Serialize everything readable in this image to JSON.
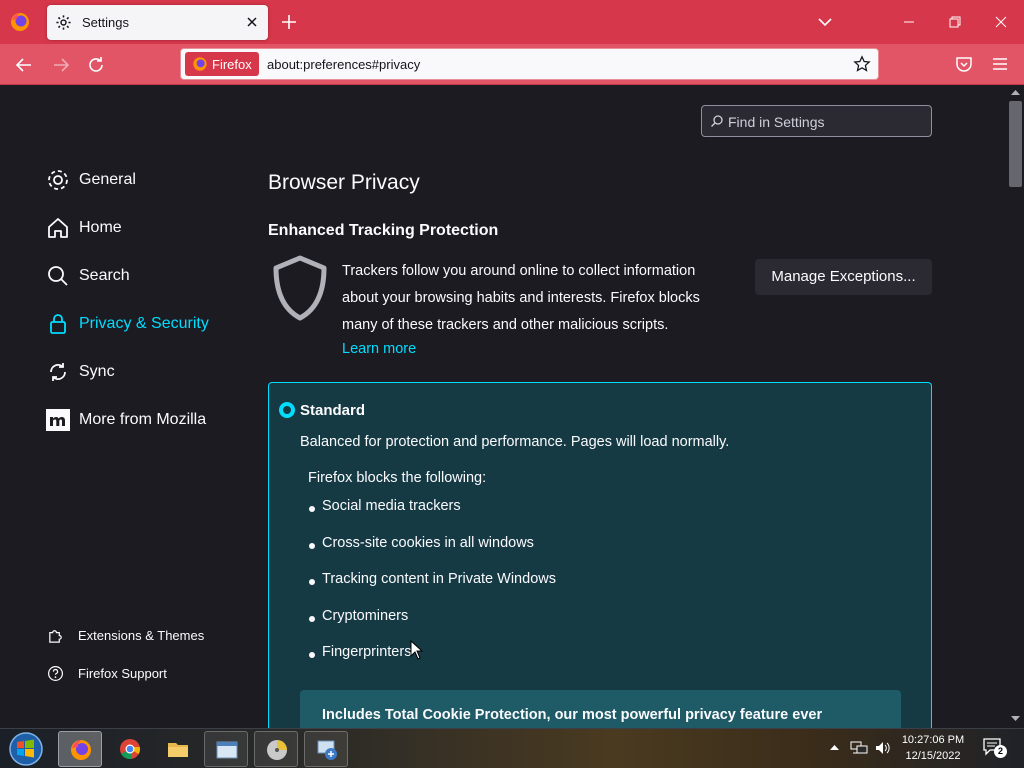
{
  "window": {
    "tab_title": "Settings",
    "icons": {
      "menu": "firefox-logo-icon",
      "tab": "gear-icon",
      "tab_close": "close-icon",
      "new_tab": "plus-icon",
      "list_all_tabs": "chevron-down-icon",
      "minimize": "minimize-icon",
      "maximize": "restore-icon",
      "close": "close-icon"
    }
  },
  "navbar": {
    "identity_label": "Firefox",
    "url": "about:preferences#privacy",
    "icons": {
      "back": "arrow-left-icon",
      "forward": "arrow-right-icon",
      "reload": "reload-icon",
      "bookmark": "star-icon",
      "pocket": "pocket-icon",
      "menu": "hamburger-icon"
    }
  },
  "search": {
    "placeholder": "Find in Settings"
  },
  "sidebar": {
    "categories": [
      {
        "label": "General",
        "icon": "gear-icon"
      },
      {
        "label": "Home",
        "icon": "home-icon"
      },
      {
        "label": "Search",
        "icon": "search-icon"
      },
      {
        "label": "Privacy & Security",
        "icon": "lock-icon",
        "selected": true
      },
      {
        "label": "Sync",
        "icon": "sync-icon"
      },
      {
        "label": "More from Mozilla",
        "icon": "mozilla-icon"
      }
    ],
    "footer": [
      {
        "label": "Extensions & Themes",
        "icon": "puzzle-icon"
      },
      {
        "label": "Firefox Support",
        "icon": "help-icon"
      }
    ]
  },
  "main": {
    "heading": "Browser Privacy",
    "etp": {
      "title": "Enhanced Tracking Protection",
      "description": "Trackers follow you around online to collect information about your browsing habits and interests. Firefox blocks many of these trackers and other malicious scripts.",
      "learn_more": "Learn more",
      "manage_button": "Manage Exceptions..."
    },
    "standard": {
      "title": "Standard",
      "selected": true,
      "description": "Balanced for protection and performance. Pages will load normally.",
      "blocks_title": "Firefox blocks the following:",
      "blocks": [
        "Social media trackers",
        "Cross-site cookies in all windows",
        "Tracking content in Private Windows",
        "Cryptominers",
        "Fingerprinters"
      ],
      "tcp_banner": "Includes Total Cookie Protection, our most powerful privacy feature ever"
    }
  },
  "taskbar": {
    "apps": [
      {
        "name": "Firefox",
        "icon": "firefox-icon",
        "state": "active"
      },
      {
        "name": "Chrome",
        "icon": "chrome-icon",
        "state": "pinned"
      },
      {
        "name": "File Explorer",
        "icon": "folder-icon",
        "state": "pinned"
      },
      {
        "name": "Window",
        "icon": "window-icon",
        "state": "open"
      },
      {
        "name": "Disk",
        "icon": "disk-icon",
        "state": "open"
      },
      {
        "name": "Network",
        "icon": "network-app-icon",
        "state": "open"
      }
    ],
    "time": "10:27:06 PM",
    "date": "12/15/2022",
    "notifications": "2"
  },
  "colors": {
    "accent": "#00ddff",
    "tabstrip": "#d7374a",
    "content_bg": "#1c1b22",
    "standard_bg": "#153a44"
  }
}
